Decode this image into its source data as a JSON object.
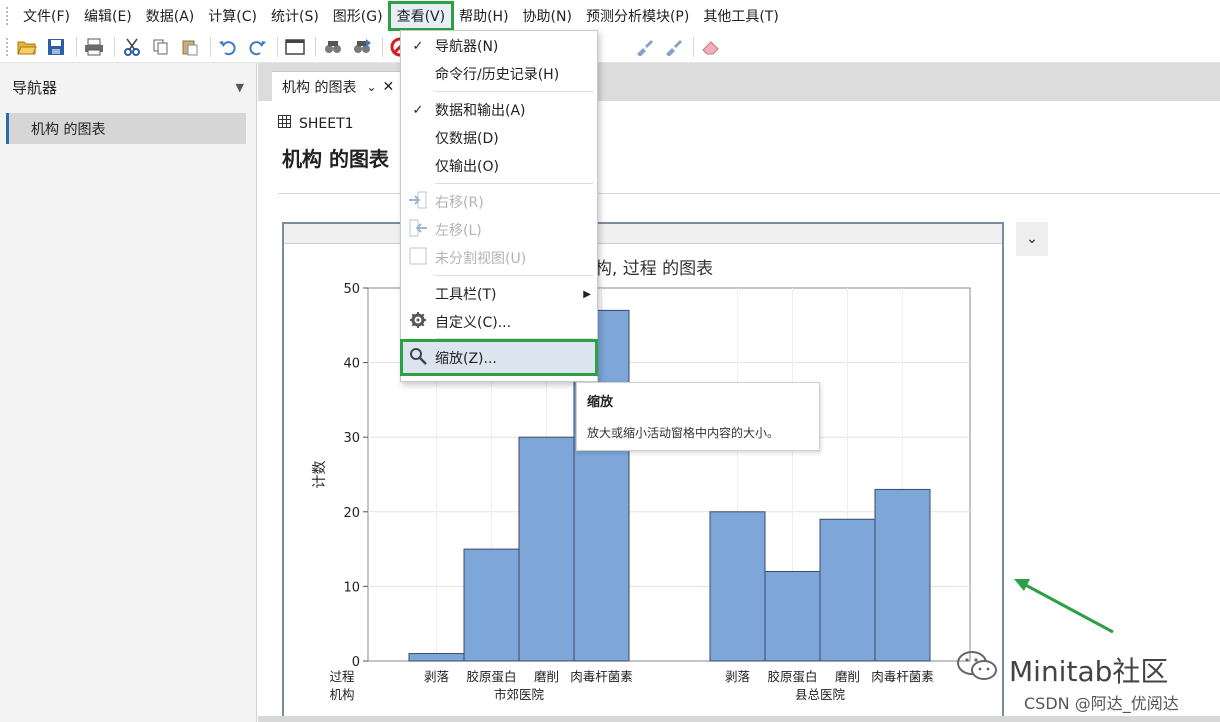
{
  "menubar": {
    "items": [
      "文件(F)",
      "编辑(E)",
      "数据(A)",
      "计算(C)",
      "统计(S)",
      "图形(G)",
      "查看(V)",
      "帮助(H)",
      "协助(N)",
      "预测分析模块(P)",
      "其他工具(T)"
    ]
  },
  "navigator": {
    "title": "导航器",
    "items": [
      "机构 的图表"
    ]
  },
  "tab": {
    "label": "机构 的图表"
  },
  "content": {
    "sheet": "SHEET1",
    "title": "机构 的图表"
  },
  "view_menu": {
    "items": [
      {
        "label": "导航器(N)",
        "checked": true,
        "disabled": false
      },
      {
        "label": "命令行/历史记录(H)",
        "checked": false,
        "disabled": false
      },
      {
        "label": "数据和输出(A)",
        "checked": true,
        "disabled": false
      },
      {
        "label": "仅数据(D)",
        "checked": false,
        "disabled": false
      },
      {
        "label": "仅输出(O)",
        "checked": false,
        "disabled": false
      },
      {
        "label": "右移(R)",
        "checked": false,
        "disabled": true
      },
      {
        "label": "左移(L)",
        "checked": false,
        "disabled": true
      },
      {
        "label": "未分割视图(U)",
        "checked": false,
        "disabled": true
      },
      {
        "label": "工具栏(T)",
        "checked": false,
        "disabled": false,
        "submenu": true
      },
      {
        "label": "自定义(C)...",
        "checked": false,
        "disabled": false
      },
      {
        "label": "缩放(Z)...",
        "checked": false,
        "disabled": false,
        "highlighted": true
      }
    ]
  },
  "tooltip": {
    "title": "缩放",
    "desc": "放大或缩小活动窗格中内容的大小。"
  },
  "chart_data": {
    "type": "bar",
    "title": "构, 过程 的图表",
    "ylabel": "计数",
    "ylim": [
      0,
      50
    ],
    "yticks": [
      0,
      10,
      20,
      30,
      40,
      50
    ],
    "bar_color": "#7ea6d8",
    "grid": true,
    "row_labels": [
      "过程",
      "机构"
    ],
    "groups": [
      {
        "name": "市郊医院",
        "categories": [
          "剥落",
          "胶原蛋白",
          "磨削",
          "肉毒杆菌素"
        ],
        "values": [
          1,
          15,
          30,
          47
        ]
      },
      {
        "name": "县总医院",
        "categories": [
          "剥落",
          "胶原蛋白",
          "磨削",
          "肉毒杆菌素"
        ],
        "values": [
          20,
          12,
          19,
          23
        ]
      }
    ]
  },
  "watermark": {
    "text": "Minitab社区",
    "csdn": "CSDN @阿达_优阅达"
  },
  "colors": {
    "accent_green": "#2ea043",
    "nav_selected": "#d6d6d6",
    "bar": "#7ea6d8"
  }
}
